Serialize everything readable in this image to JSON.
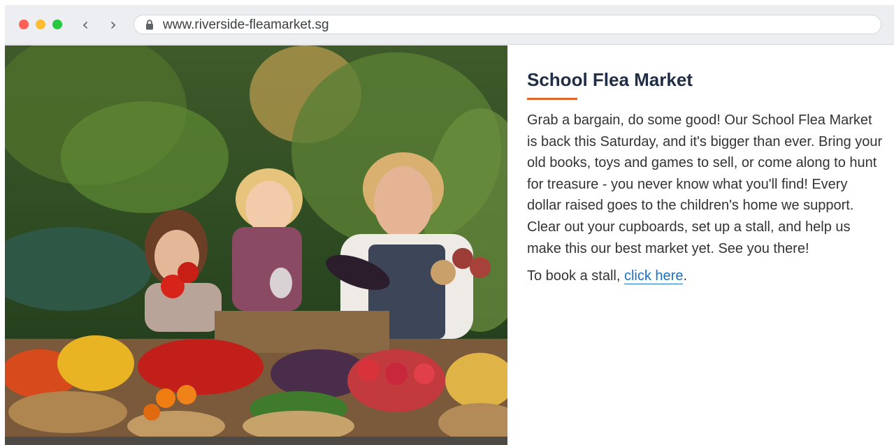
{
  "browser": {
    "url": "www.riverside-fleamarket.sg",
    "back_icon": "chevron-left-icon",
    "forward_icon": "chevron-right-icon",
    "lock_icon": "lock-icon",
    "traffic_lights": [
      "#ff5f57",
      "#febc2e",
      "#28c840"
    ]
  },
  "article": {
    "title": "School Flea Market",
    "accent_color": "#e0652a",
    "paragraph": "Grab a bargain, do some good! Our School Flea Market is back this Saturday, and it's bigger than ever. Bring your old books, toys and games to sell, or come along to hunt for treasure - you never know what you'll find! Every dollar raised goes to the children's home we support. Clear out your cupboards, set up a stall, and help us make this our best market yet. See you there!",
    "book_prefix": "To book a stall, ",
    "book_link": "click here",
    "book_suffix": "."
  }
}
